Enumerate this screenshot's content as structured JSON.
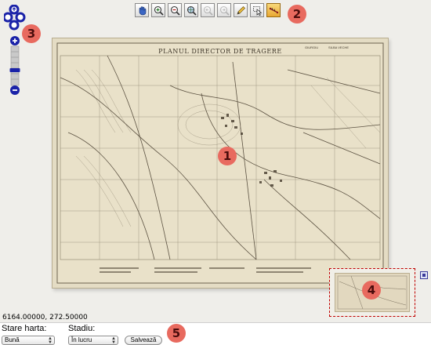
{
  "toolbar": {
    "tools": [
      {
        "name": "pan",
        "icon": "hand-icon"
      },
      {
        "name": "zoom-in",
        "icon": "zoom-in-icon"
      },
      {
        "name": "zoom-out",
        "icon": "zoom-out-icon"
      },
      {
        "name": "zoom-extent",
        "icon": "globe-zoom-icon"
      },
      {
        "name": "zoom-previous",
        "icon": "zoom-previous-icon"
      },
      {
        "name": "zoom-next",
        "icon": "zoom-next-icon"
      },
      {
        "name": "draw",
        "icon": "pencil-icon"
      },
      {
        "name": "select",
        "icon": "select-icon"
      },
      {
        "name": "measure",
        "icon": "ruler-icon"
      }
    ]
  },
  "badges": {
    "map": "1",
    "toolbar": "2",
    "navigation": "3",
    "overview": "4",
    "form": "5"
  },
  "map": {
    "title": "PLANUL DIRECTOR DE TRAGERE",
    "sheet_label": "GIURGIU",
    "sheet_name": "SILBA VECHE"
  },
  "coordinates": "6164.00000, 272.50000",
  "form": {
    "stare_label": "Stare harta:",
    "stare_value": "Bună",
    "stadiu_label": "Stadiu:",
    "stadiu_value": "În lucru",
    "save_label": "Salvează"
  },
  "colors": {
    "badge": "#e86a5f",
    "nav_blue": "#1a22a8",
    "overview_border": "#c00000",
    "active_tool": "#f0c050"
  }
}
